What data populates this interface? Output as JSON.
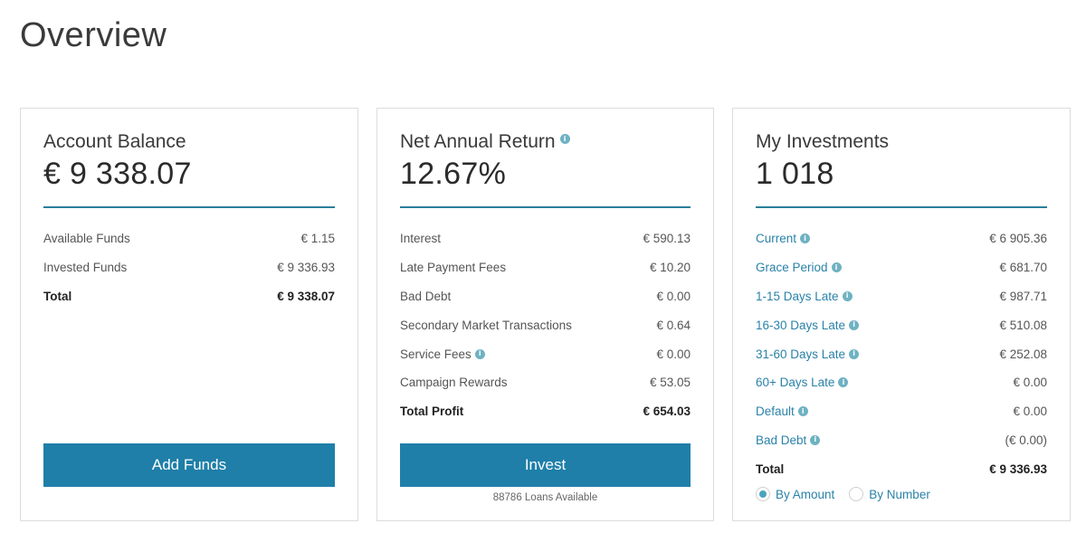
{
  "page": {
    "title": "Overview"
  },
  "account_balance": {
    "label": "Account Balance",
    "value": "€ 9 338.07",
    "rows": [
      {
        "label": "Available Funds",
        "value": "€ 1.15"
      },
      {
        "label": "Invested Funds",
        "value": "€ 9 336.93"
      },
      {
        "label": "Total",
        "value": "€ 9 338.07"
      }
    ],
    "button_label": "Add Funds"
  },
  "net_annual_return": {
    "label": "Net Annual Return",
    "value": "12.67%",
    "rows": [
      {
        "label": "Interest",
        "value": "€ 590.13"
      },
      {
        "label": "Late Payment Fees",
        "value": "€ 10.20"
      },
      {
        "label": "Bad Debt",
        "value": "€ 0.00"
      },
      {
        "label": "Secondary Market Transactions",
        "value": "€ 0.64"
      },
      {
        "label": "Service Fees",
        "value": "€ 0.00"
      },
      {
        "label": "Campaign Rewards",
        "value": "€ 53.05"
      },
      {
        "label": "Total Profit",
        "value": "€ 654.03"
      }
    ],
    "button_label": "Invest",
    "loans_available": "88786 Loans Available"
  },
  "my_investments": {
    "label": "My Investments",
    "value": "1 018",
    "rows": [
      {
        "label": "Current",
        "value": "€ 6 905.36"
      },
      {
        "label": "Grace Period",
        "value": "€ 681.70"
      },
      {
        "label": "1-15 Days Late",
        "value": "€ 987.71"
      },
      {
        "label": "16-30 Days Late",
        "value": "€ 510.08"
      },
      {
        "label": "31-60 Days Late",
        "value": "€ 252.08"
      },
      {
        "label": "60+ Days Late",
        "value": "€ 0.00"
      },
      {
        "label": "Default",
        "value": "€ 0.00"
      },
      {
        "label": "Bad Debt",
        "value": "(€ 0.00)"
      },
      {
        "label": "Total",
        "value": "€ 9 336.93"
      }
    ],
    "radio_options": [
      "By Amount",
      "By Number"
    ],
    "selected_option": "By Amount"
  },
  "info_icon_glyph": "i",
  "colors": {
    "accent": "#1f7fa9",
    "link": "#2a82a8",
    "divider": "#2a7f9a"
  }
}
